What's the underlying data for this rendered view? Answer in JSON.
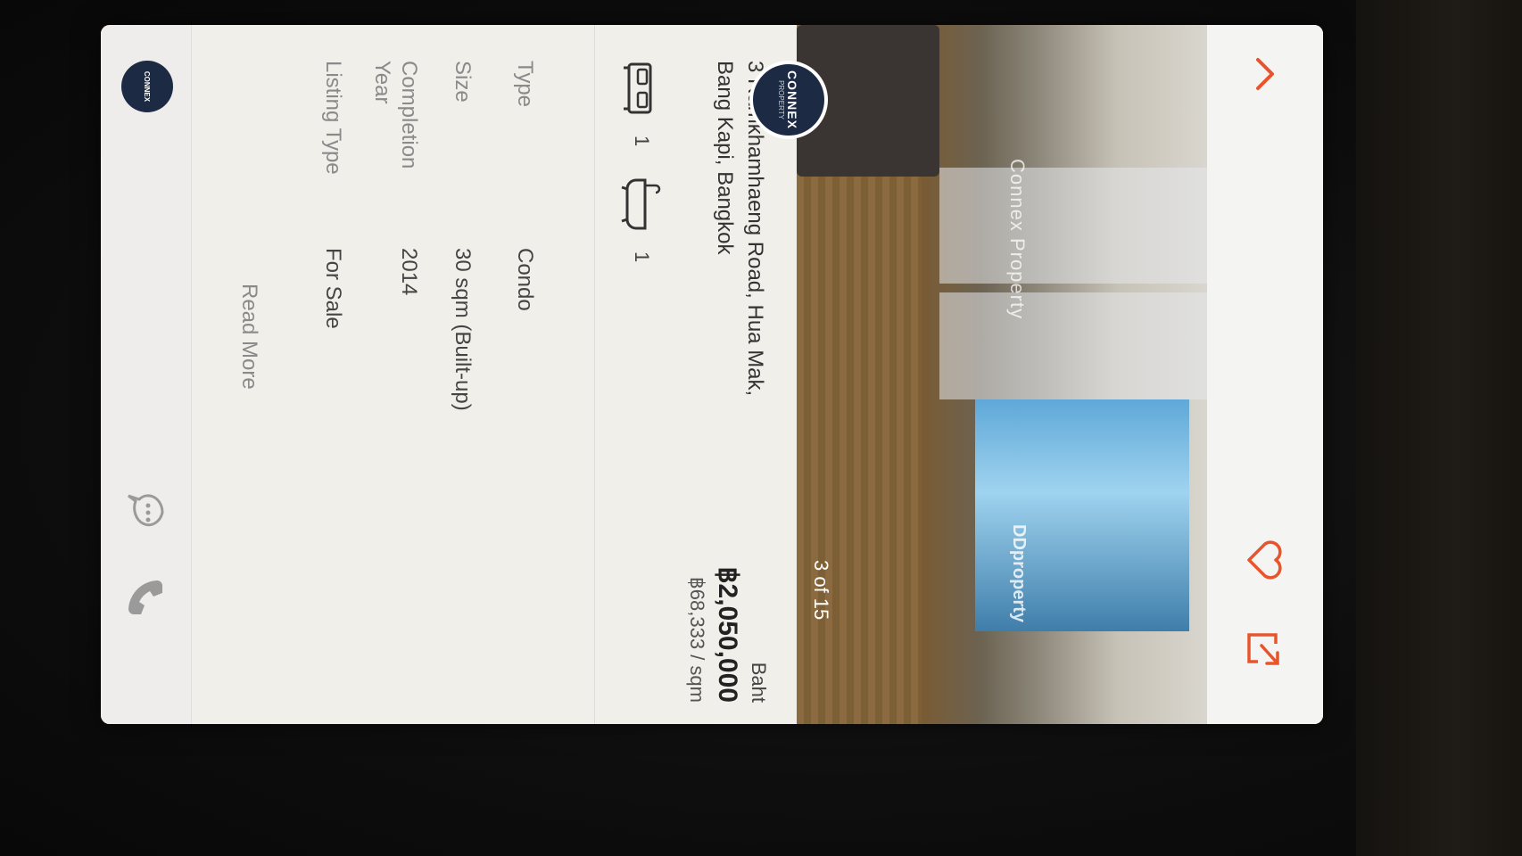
{
  "header": {
    "back_icon": "chevron-up-icon",
    "favorite_icon": "heart-icon",
    "share_icon": "share-icon",
    "accent_color": "#e8542b"
  },
  "gallery": {
    "watermark_agent": "Connex Property",
    "watermark_portal": "DDproperty",
    "counter": "3 of 15"
  },
  "agent": {
    "logo_text": "CONNEX",
    "logo_subtext": "PROPERTY"
  },
  "listing": {
    "address": "3 Ramkhamhaeng Road, Hua Mak, Bang Kapi, Bangkok",
    "price_unit": "Baht",
    "price": "฿2,050,000",
    "price_per_sqm": "฿68,333 / sqm",
    "bedrooms": "1",
    "bathrooms": "1"
  },
  "specs": [
    {
      "label": "Type",
      "value": "Condo"
    },
    {
      "label": "Size",
      "value": "30 sqm (Built-up)"
    },
    {
      "label": "Completion Year",
      "value": "2014"
    },
    {
      "label": "Listing Type",
      "value": "For Sale"
    }
  ],
  "read_more": "Read More",
  "bottom_bar": {
    "logo_text": "CONNEX",
    "chat_icon": "chat-bubble-icon",
    "call_icon": "phone-icon"
  }
}
